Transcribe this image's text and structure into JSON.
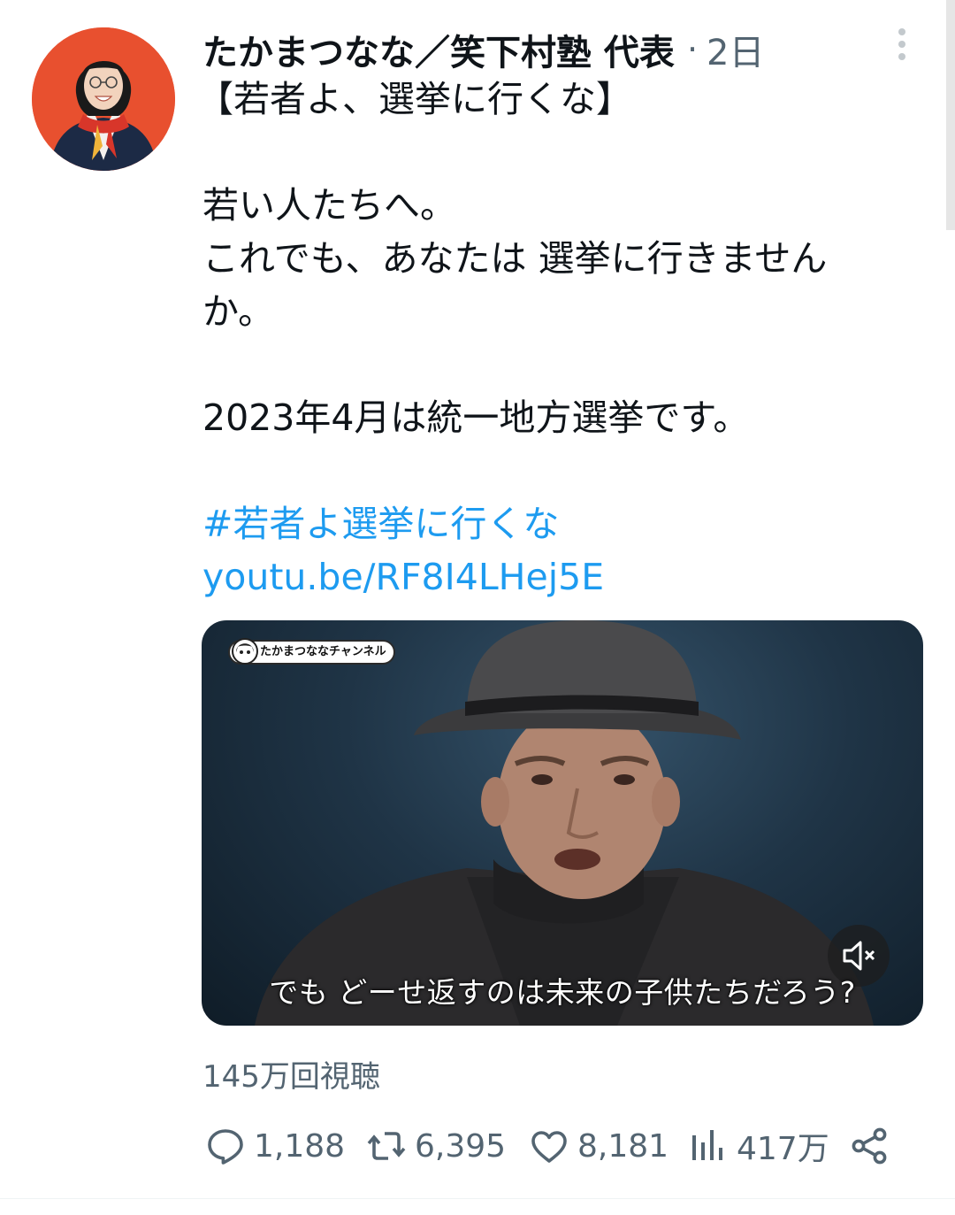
{
  "tweet": {
    "author_name": "たかまつなな／笑下村塾 代表",
    "separator": "·",
    "time": "2日",
    "text_lines": [
      "【若者よ、選挙に行くな】",
      "若い人たちへ。",
      "これでも、あなたは 選挙に行きません",
      "か。",
      "2023年4月は統一地方選挙です。"
    ],
    "hashtag": "#若者よ選挙に行くな",
    "link": "youtu.be/RF8I4LHej5E"
  },
  "video": {
    "channel_badge": "たかまつななチャンネル",
    "subtitle": "でも どーせ返すのは未来の子供たちだろう?",
    "muted": true
  },
  "views_text": "145万回視聴",
  "actions": {
    "replies": "1,188",
    "retweets": "6,395",
    "likes": "8,181",
    "views": "417万"
  },
  "colors": {
    "link": "#1d9bf0",
    "secondary_text": "#536471",
    "primary_text": "#0f1419",
    "avatar_background": "#e64a2e"
  },
  "icons": [
    "more-vertical-icon",
    "mute-icon",
    "reply-icon",
    "retweet-icon",
    "like-icon",
    "views-icon",
    "share-icon"
  ]
}
